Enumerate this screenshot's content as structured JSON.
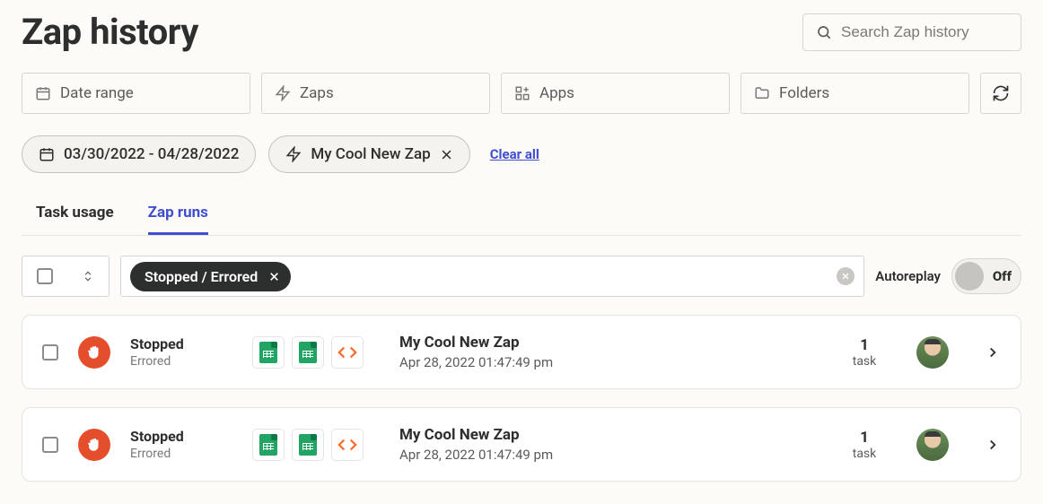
{
  "header": {
    "title": "Zap history",
    "search_placeholder": "Search Zap history"
  },
  "filters": {
    "date_range_label": "Date range",
    "zaps_label": "Zaps",
    "apps_label": "Apps",
    "folders_label": "Folders"
  },
  "active_filters": {
    "date_range": "03/30/2022 - 04/28/2022",
    "zap_name": "My Cool New Zap",
    "clear_all_label": "Clear all"
  },
  "tabs": [
    {
      "label": "Task usage",
      "active": false
    },
    {
      "label": "Zap runs",
      "active": true
    }
  ],
  "status_filter": {
    "chip_label": "Stopped / Errored"
  },
  "autoreplay": {
    "label": "Autoreplay",
    "state": "Off"
  },
  "runs": [
    {
      "status_main": "Stopped",
      "status_sub": "Errored",
      "zap_name": "My Cool New Zap",
      "timestamp": "Apr 28, 2022 01:47:49 pm",
      "task_count": "1",
      "task_label": "task"
    },
    {
      "status_main": "Stopped",
      "status_sub": "Errored",
      "zap_name": "My Cool New Zap",
      "timestamp": "Apr 28, 2022 01:47:49 pm",
      "task_count": "1",
      "task_label": "task"
    }
  ]
}
